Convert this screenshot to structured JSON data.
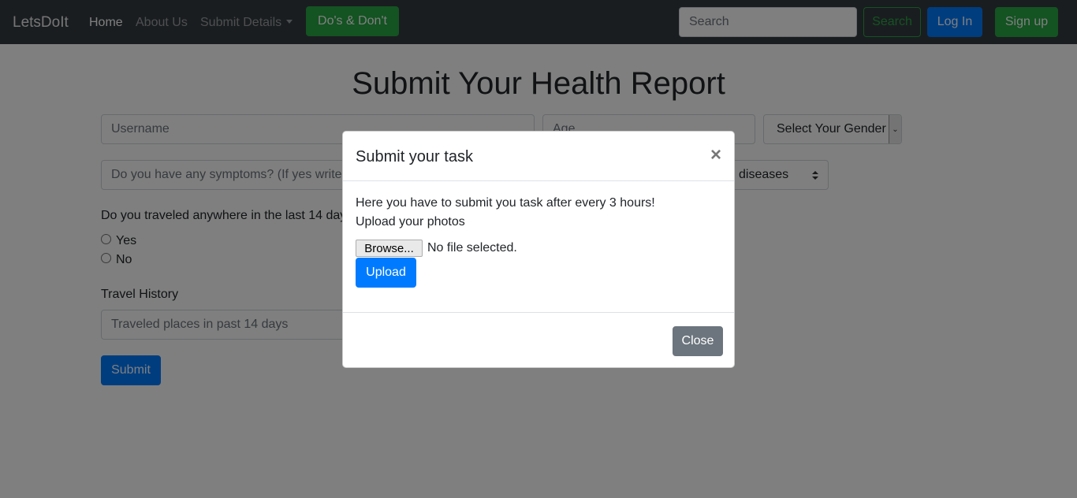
{
  "navbar": {
    "brand": "LetsDoIt",
    "links": [
      "Home",
      "About Us",
      "Submit Details"
    ],
    "dos_donts": "Do's & Don't",
    "search_placeholder": "Search",
    "search_button": "Search",
    "login": "Log In",
    "signup": "Sign up"
  },
  "form": {
    "title": "Submit Your Health Report",
    "username_placeholder": "Username",
    "age_placeholder": "Age",
    "gender_select": "Select Your Gender",
    "symptoms_placeholder": "Do you have any symptoms? (If yes write",
    "diseases_select": "diseases",
    "travel_question": "Do you traveled anywhere in the last 14 day",
    "radio_yes": "Yes",
    "radio_no": "No",
    "travel_history_label": "Travel History",
    "travel_places_placeholder": "Traveled places in past 14 days",
    "submit": "Submit"
  },
  "modal": {
    "title": "Submit your task",
    "close_symbol": "×",
    "instruction": "Here you have to submit you task after every 3 hours!",
    "upload_label": "Upload your photos",
    "browse_button": "Browse...",
    "file_status": "No file selected.",
    "upload_button": "Upload",
    "close_button": "Close"
  }
}
